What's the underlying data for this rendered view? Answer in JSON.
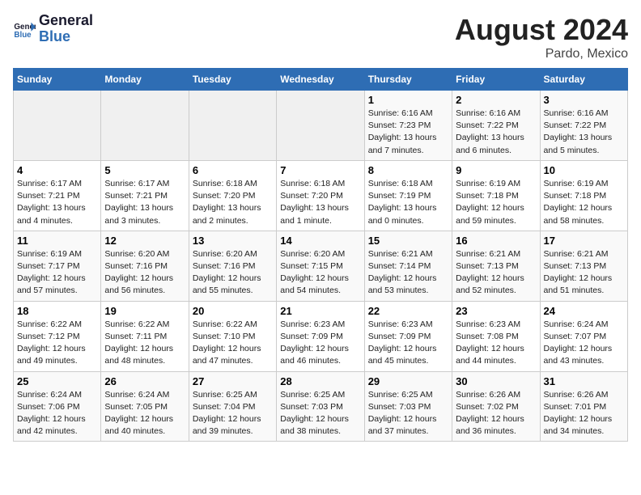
{
  "header": {
    "logo_line1": "General",
    "logo_line2": "Blue",
    "title": "August 2024",
    "subtitle": "Pardo, Mexico"
  },
  "calendar": {
    "days_of_week": [
      "Sunday",
      "Monday",
      "Tuesday",
      "Wednesday",
      "Thursday",
      "Friday",
      "Saturday"
    ],
    "weeks": [
      [
        {
          "day": "",
          "info": ""
        },
        {
          "day": "",
          "info": ""
        },
        {
          "day": "",
          "info": ""
        },
        {
          "day": "",
          "info": ""
        },
        {
          "day": "1",
          "info": "Sunrise: 6:16 AM\nSunset: 7:23 PM\nDaylight: 13 hours\nand 7 minutes."
        },
        {
          "day": "2",
          "info": "Sunrise: 6:16 AM\nSunset: 7:22 PM\nDaylight: 13 hours\nand 6 minutes."
        },
        {
          "day": "3",
          "info": "Sunrise: 6:16 AM\nSunset: 7:22 PM\nDaylight: 13 hours\nand 5 minutes."
        }
      ],
      [
        {
          "day": "4",
          "info": "Sunrise: 6:17 AM\nSunset: 7:21 PM\nDaylight: 13 hours\nand 4 minutes."
        },
        {
          "day": "5",
          "info": "Sunrise: 6:17 AM\nSunset: 7:21 PM\nDaylight: 13 hours\nand 3 minutes."
        },
        {
          "day": "6",
          "info": "Sunrise: 6:18 AM\nSunset: 7:20 PM\nDaylight: 13 hours\nand 2 minutes."
        },
        {
          "day": "7",
          "info": "Sunrise: 6:18 AM\nSunset: 7:20 PM\nDaylight: 13 hours\nand 1 minute."
        },
        {
          "day": "8",
          "info": "Sunrise: 6:18 AM\nSunset: 7:19 PM\nDaylight: 13 hours\nand 0 minutes."
        },
        {
          "day": "9",
          "info": "Sunrise: 6:19 AM\nSunset: 7:18 PM\nDaylight: 12 hours\nand 59 minutes."
        },
        {
          "day": "10",
          "info": "Sunrise: 6:19 AM\nSunset: 7:18 PM\nDaylight: 12 hours\nand 58 minutes."
        }
      ],
      [
        {
          "day": "11",
          "info": "Sunrise: 6:19 AM\nSunset: 7:17 PM\nDaylight: 12 hours\nand 57 minutes."
        },
        {
          "day": "12",
          "info": "Sunrise: 6:20 AM\nSunset: 7:16 PM\nDaylight: 12 hours\nand 56 minutes."
        },
        {
          "day": "13",
          "info": "Sunrise: 6:20 AM\nSunset: 7:16 PM\nDaylight: 12 hours\nand 55 minutes."
        },
        {
          "day": "14",
          "info": "Sunrise: 6:20 AM\nSunset: 7:15 PM\nDaylight: 12 hours\nand 54 minutes."
        },
        {
          "day": "15",
          "info": "Sunrise: 6:21 AM\nSunset: 7:14 PM\nDaylight: 12 hours\nand 53 minutes."
        },
        {
          "day": "16",
          "info": "Sunrise: 6:21 AM\nSunset: 7:13 PM\nDaylight: 12 hours\nand 52 minutes."
        },
        {
          "day": "17",
          "info": "Sunrise: 6:21 AM\nSunset: 7:13 PM\nDaylight: 12 hours\nand 51 minutes."
        }
      ],
      [
        {
          "day": "18",
          "info": "Sunrise: 6:22 AM\nSunset: 7:12 PM\nDaylight: 12 hours\nand 49 minutes."
        },
        {
          "day": "19",
          "info": "Sunrise: 6:22 AM\nSunset: 7:11 PM\nDaylight: 12 hours\nand 48 minutes."
        },
        {
          "day": "20",
          "info": "Sunrise: 6:22 AM\nSunset: 7:10 PM\nDaylight: 12 hours\nand 47 minutes."
        },
        {
          "day": "21",
          "info": "Sunrise: 6:23 AM\nSunset: 7:09 PM\nDaylight: 12 hours\nand 46 minutes."
        },
        {
          "day": "22",
          "info": "Sunrise: 6:23 AM\nSunset: 7:09 PM\nDaylight: 12 hours\nand 45 minutes."
        },
        {
          "day": "23",
          "info": "Sunrise: 6:23 AM\nSunset: 7:08 PM\nDaylight: 12 hours\nand 44 minutes."
        },
        {
          "day": "24",
          "info": "Sunrise: 6:24 AM\nSunset: 7:07 PM\nDaylight: 12 hours\nand 43 minutes."
        }
      ],
      [
        {
          "day": "25",
          "info": "Sunrise: 6:24 AM\nSunset: 7:06 PM\nDaylight: 12 hours\nand 42 minutes."
        },
        {
          "day": "26",
          "info": "Sunrise: 6:24 AM\nSunset: 7:05 PM\nDaylight: 12 hours\nand 40 minutes."
        },
        {
          "day": "27",
          "info": "Sunrise: 6:25 AM\nSunset: 7:04 PM\nDaylight: 12 hours\nand 39 minutes."
        },
        {
          "day": "28",
          "info": "Sunrise: 6:25 AM\nSunset: 7:03 PM\nDaylight: 12 hours\nand 38 minutes."
        },
        {
          "day": "29",
          "info": "Sunrise: 6:25 AM\nSunset: 7:03 PM\nDaylight: 12 hours\nand 37 minutes."
        },
        {
          "day": "30",
          "info": "Sunrise: 6:26 AM\nSunset: 7:02 PM\nDaylight: 12 hours\nand 36 minutes."
        },
        {
          "day": "31",
          "info": "Sunrise: 6:26 AM\nSunset: 7:01 PM\nDaylight: 12 hours\nand 34 minutes."
        }
      ]
    ]
  }
}
